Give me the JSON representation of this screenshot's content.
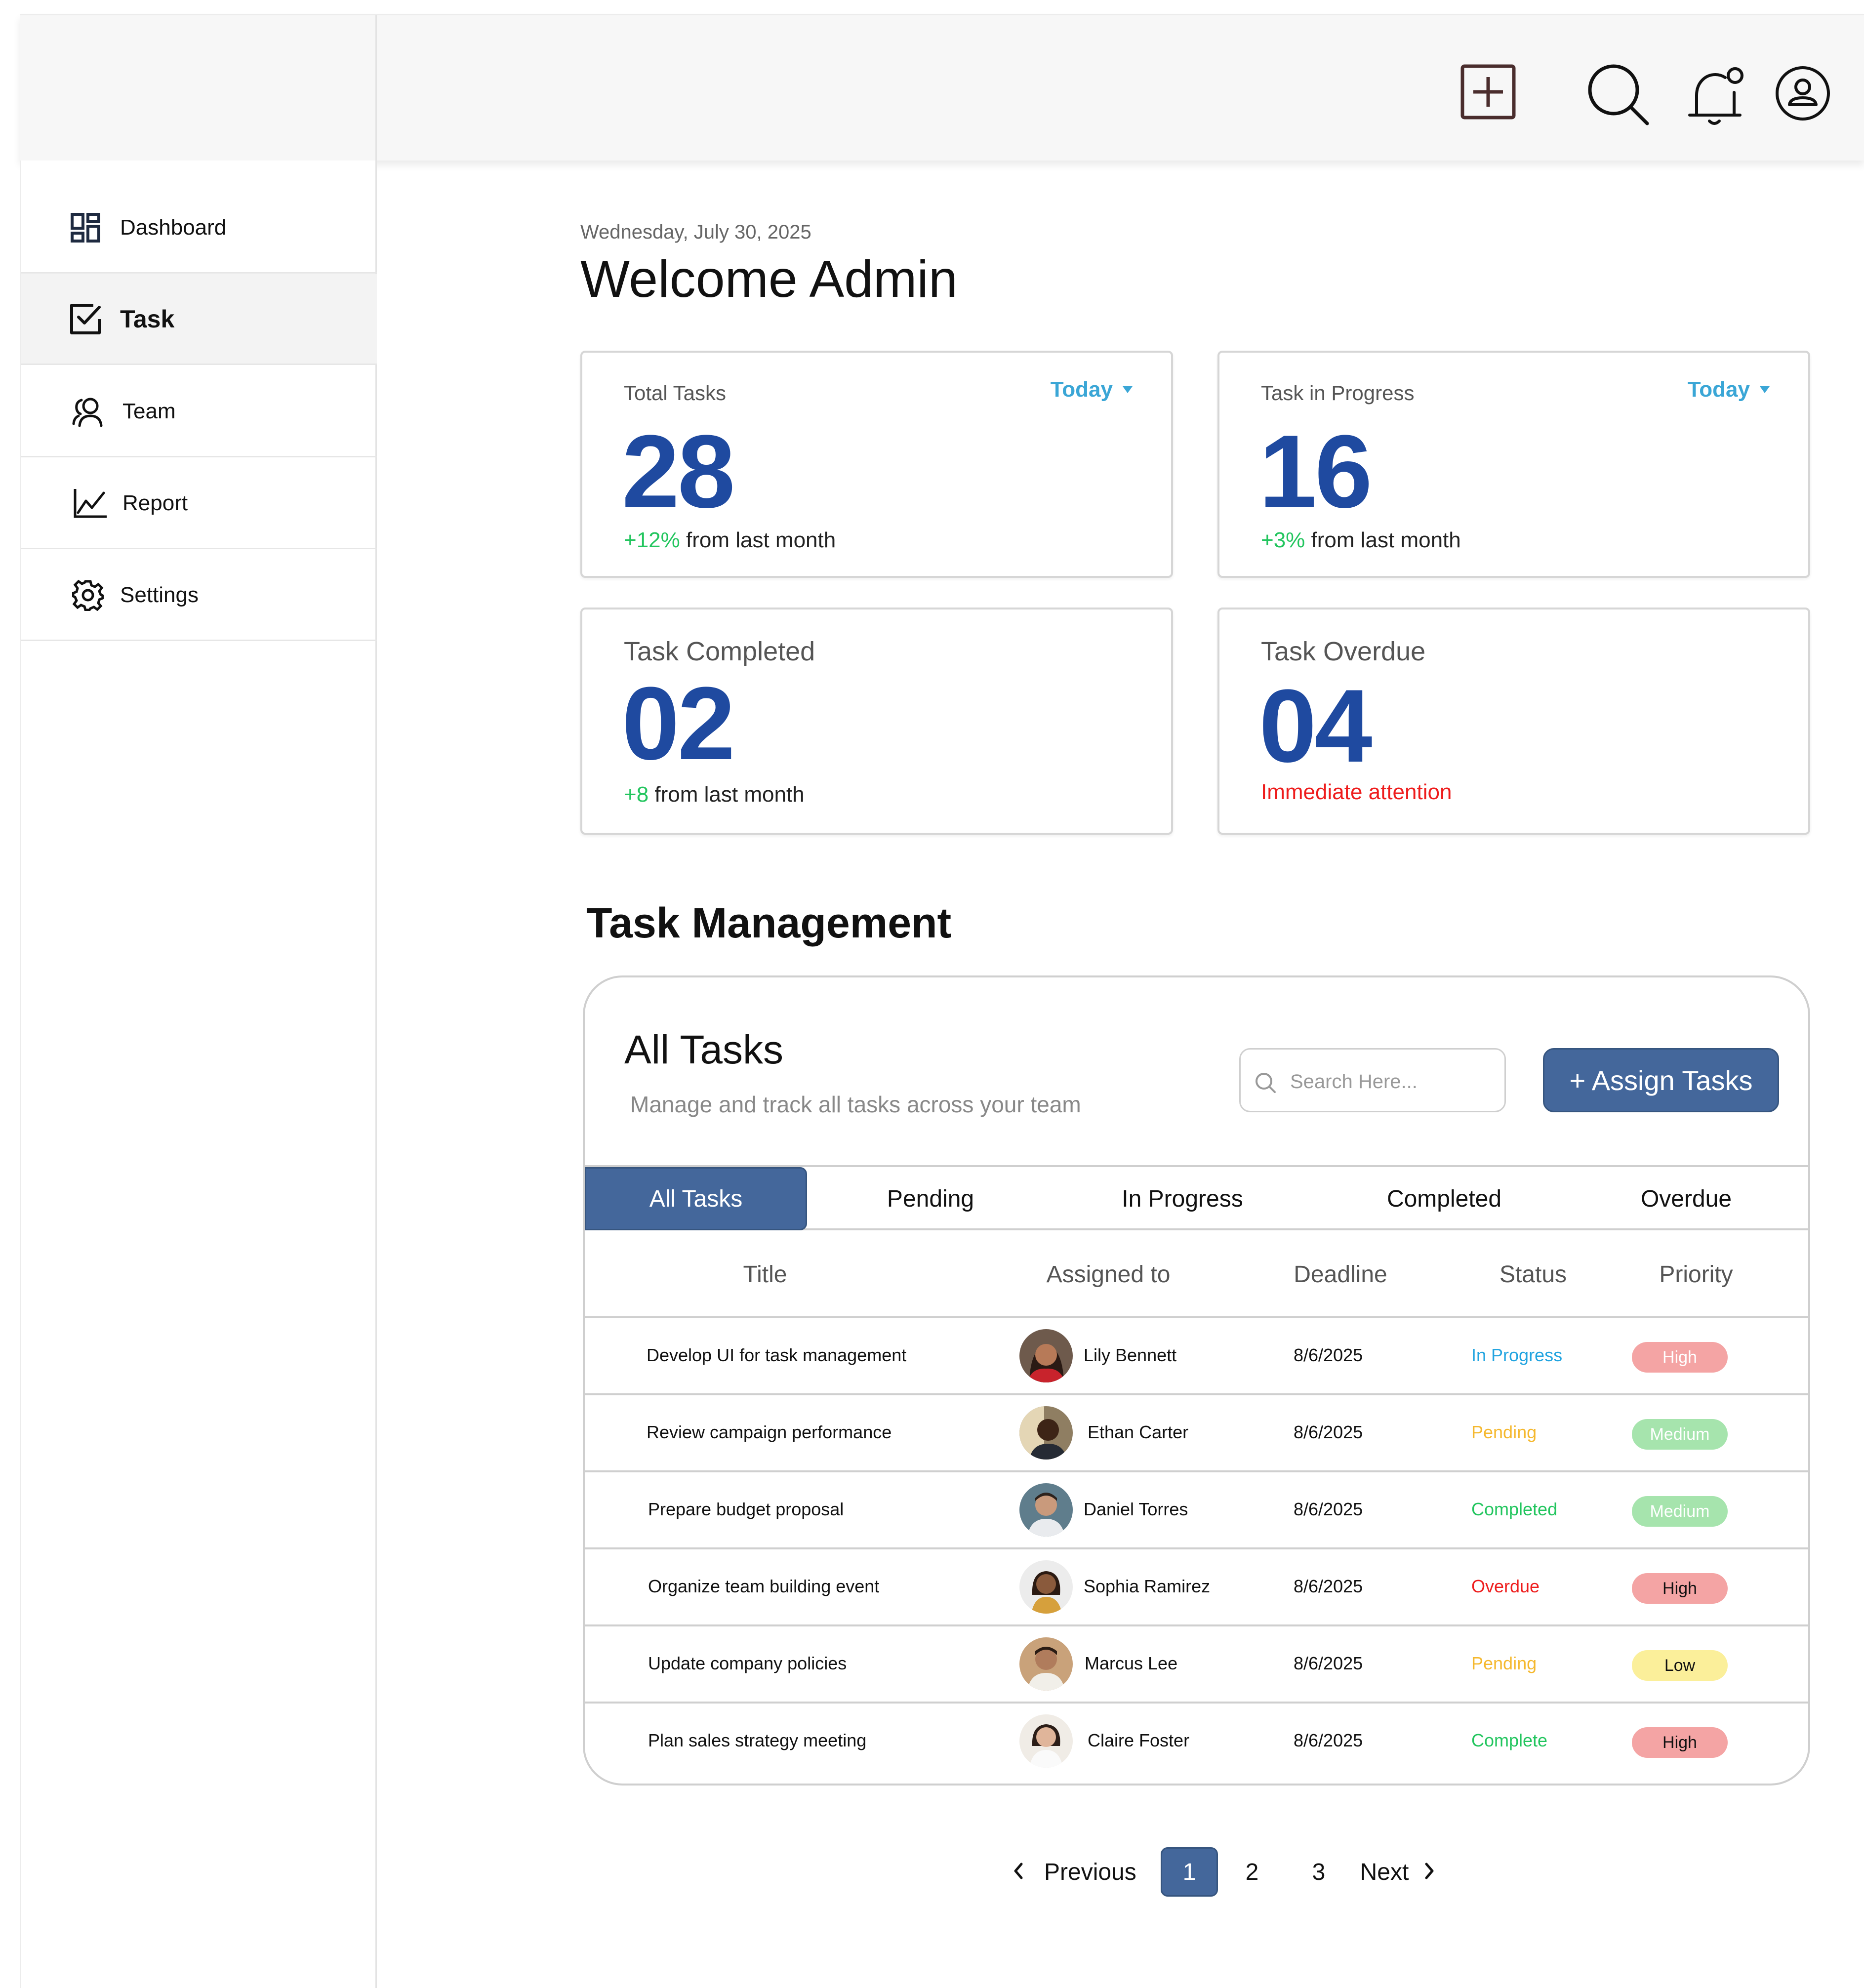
{
  "header": {
    "icons": [
      "add-icon",
      "search-icon",
      "notification-bell-icon",
      "user-profile-icon"
    ]
  },
  "sidebar": {
    "items": [
      {
        "label": "Dashboard",
        "icon": "dashboard-icon"
      },
      {
        "label": "Task",
        "icon": "task-checkbox-icon",
        "active": true
      },
      {
        "label": "Team",
        "icon": "team-icon"
      },
      {
        "label": "Report",
        "icon": "chart-line-icon"
      },
      {
        "label": "Settings",
        "icon": "gear-icon"
      }
    ]
  },
  "main": {
    "date": "Wednesday, July 30, 2025",
    "welcome": "Welcome Admin",
    "stats": [
      {
        "label": "Total Tasks",
        "value": "28",
        "delta": "+12%",
        "sub": " from last month",
        "dropdown": "Today"
      },
      {
        "label": "Task in Progress",
        "value": "16",
        "delta": "+3%",
        "sub": " from last month",
        "dropdown": "Today"
      },
      {
        "label": "Task Completed",
        "value": "02",
        "delta": "+8",
        "sub": " from last month"
      },
      {
        "label": "Task Overdue",
        "value": "04",
        "alert": "Immediate attention"
      }
    ],
    "section_title": "Task Management"
  },
  "tasks": {
    "title": "All Tasks",
    "subtitle": "Manage and track all tasks across your team",
    "search_placeholder": "Search Here...",
    "assign_label": "+ Assign Tasks",
    "tabs": [
      "All Tasks",
      "Pending",
      "In Progress",
      "Completed",
      "Overdue"
    ],
    "columns": [
      "Title",
      "Assigned to",
      "Deadline",
      "Status",
      "Priority"
    ],
    "rows": [
      {
        "title": "Develop UI for task management",
        "assignee": "Lily Bennett",
        "deadline": "8/6/2025",
        "status": "In Progress",
        "priority": "High"
      },
      {
        "title": "Review campaign performance",
        "assignee": "Ethan Carter",
        "deadline": "8/6/2025",
        "status": "Pending",
        "priority": "Medium"
      },
      {
        "title": "Prepare budget proposal",
        "assignee": "Daniel Torres",
        "deadline": "8/6/2025",
        "status": "Completed",
        "priority": "Medium"
      },
      {
        "title": "Organize team building event",
        "assignee": "Sophia Ramirez",
        "deadline": "8/6/2025",
        "status": "Overdue",
        "priority": "High"
      },
      {
        "title": "Update company policies",
        "assignee": "Marcus Lee",
        "deadline": "8/6/2025",
        "status": "Pending",
        "priority": "Low"
      },
      {
        "title": "Plan sales strategy meeting",
        "assignee": "Claire Foster",
        "deadline": "8/6/2025",
        "status": "Complete",
        "priority": "High"
      }
    ]
  },
  "colors": {
    "accent": "#44679b",
    "stat_value": "#1f4aa0",
    "link_blue": "#3aa6d6",
    "positive": "#22c55e",
    "alert": "#ee1c1c",
    "status_in_progress": "#22a4e0",
    "status_pending": "#f5b82e",
    "status_completed": "#22c55e",
    "status_overdue": "#ee1c1c",
    "priority_high": "#f4a4a4",
    "priority_medium": "#a6e4ad",
    "priority_low": "#fbef9a"
  },
  "pagination": {
    "previous": "Previous",
    "pages": [
      "1",
      "2",
      "3"
    ],
    "current": "1",
    "next": "Next"
  }
}
